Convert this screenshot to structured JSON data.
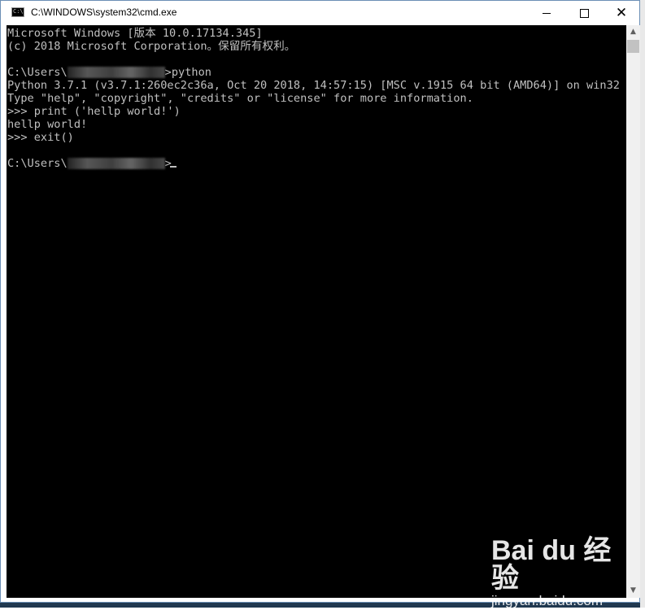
{
  "window": {
    "title": "C:\\WINDOWS\\system32\\cmd.exe",
    "icon_text": "C:\\"
  },
  "controls": {
    "minimize_icon": "minimize-icon",
    "maximize_icon": "maximize-icon",
    "close_icon": "close-icon"
  },
  "console": {
    "lines": [
      "Microsoft Windows [版本 10.0.17134.345]",
      "(c) 2018 Microsoft Corporation。保留所有权利。",
      "",
      ">python",
      "Python 3.7.1 (v3.7.1:260ec2c36a, Oct 20 2018, 14:57:15) [MSC v.1915 64 bit (AMD64)] on win32",
      "Type \"help\", \"copyright\", \"credits\" or \"license\" for more information.",
      ">>> print ('hellp world!')",
      "hellp world!",
      ">>> exit()",
      "",
      ">"
    ],
    "prompt_prefix": "C:\\Users\\",
    "colors": {
      "background": "#000000",
      "text": "#c0c0c0"
    }
  },
  "watermark": {
    "logo": "Bai du 经验",
    "url": "jingyan.baidu.com"
  }
}
